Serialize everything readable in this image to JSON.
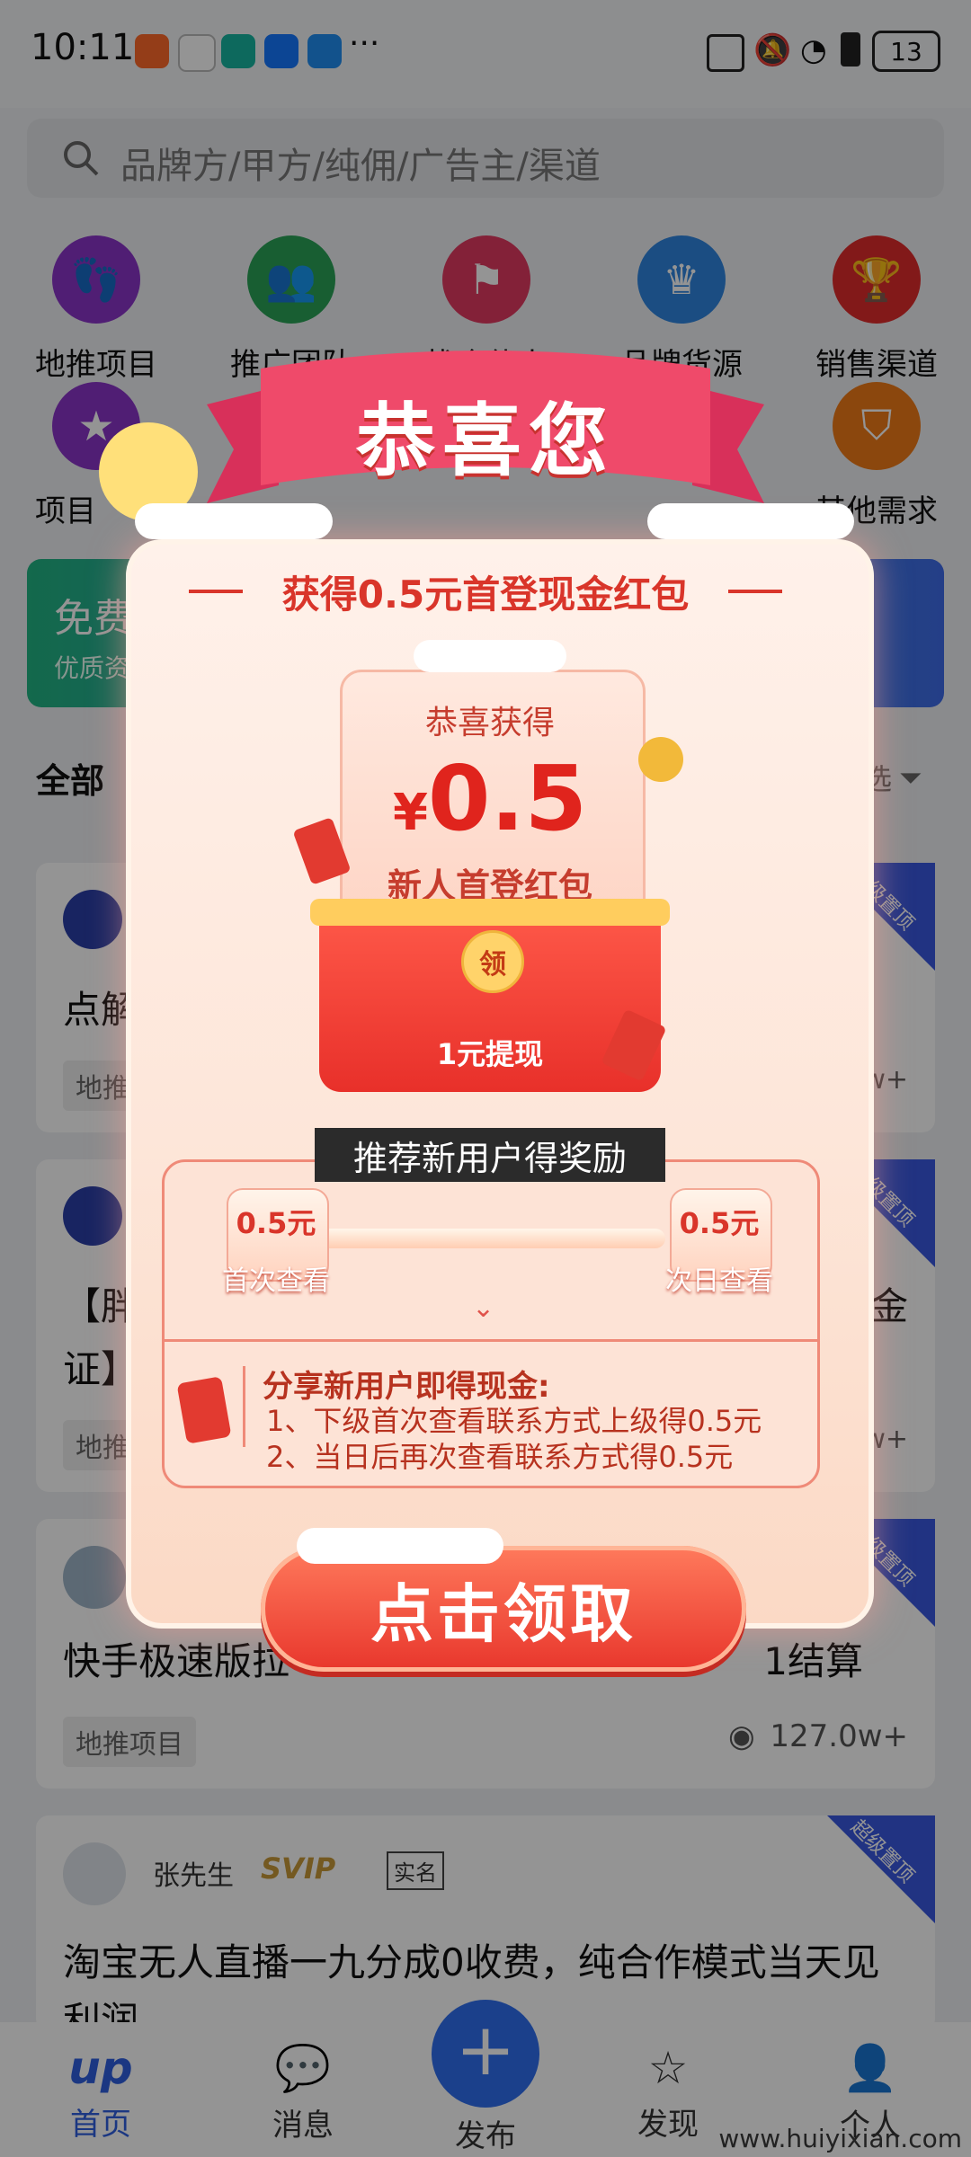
{
  "status": {
    "time": "10:11",
    "battery": "13",
    "more": "···"
  },
  "search": {
    "placeholder": "品牌方/甲方/纯佣/广告主/渠道"
  },
  "grid": {
    "row1": [
      "地推项目",
      "推广团队",
      "找合伙人",
      "品牌货源",
      "销售渠道"
    ],
    "row2_left": "项目",
    "row2_right": "其他需求",
    "colors": [
      "#8b35c9",
      "#2aa356",
      "#e23a61",
      "#2f86e0",
      "#e02b2b"
    ]
  },
  "promo": {
    "title": "免费",
    "subtitle": "优质资"
  },
  "feed": {
    "tab": "全部",
    "filter_short": "选",
    "ribbon": "超级置顶",
    "cards": [
      {
        "title_fragment": "点解",
        "tag": "地推",
        "views_fragment": "w+"
      },
      {
        "title_fragment_1": "【胖",
        "title_fragment_2": "证】",
        "title_end": "金",
        "tag": "地推",
        "views_fragment": "w+"
      },
      {
        "title_start": "快手极速版拉",
        "title_end": "1结算",
        "tag": "地推项目",
        "views": "127.0w+"
      },
      {
        "author": "张先生",
        "vip": "SVIP",
        "verify": "实名",
        "title": "淘宝无人直播一九分成0收费，纯合作模式当天见",
        "title_line2": "利润"
      }
    ]
  },
  "nav": {
    "items": [
      "首页",
      "消息",
      "发布",
      "发现",
      "个人"
    ],
    "active": "首页"
  },
  "modal": {
    "banner": "恭喜您",
    "subtitle": "获得0.5元首登现金红包",
    "card_title": "恭喜获得",
    "currency": "¥",
    "amount": "0.5",
    "card_desc": "新人首登红包",
    "seal": "领",
    "envelope_label": "1元提现",
    "recommend": "推荐新用户得奖励",
    "steps": [
      {
        "amount": "0.5元",
        "label": "首次查看"
      },
      {
        "amount": "0.5元",
        "label": "次日查看"
      }
    ],
    "share_title": "分享新用户即得现金:",
    "share_lines": [
      "1、下级首次查看联系方式上级得0.5元",
      "2、当日后再次查看联系方式得0.5元"
    ],
    "claim": "点击领取"
  },
  "watermark": "www.huiyixian.com"
}
